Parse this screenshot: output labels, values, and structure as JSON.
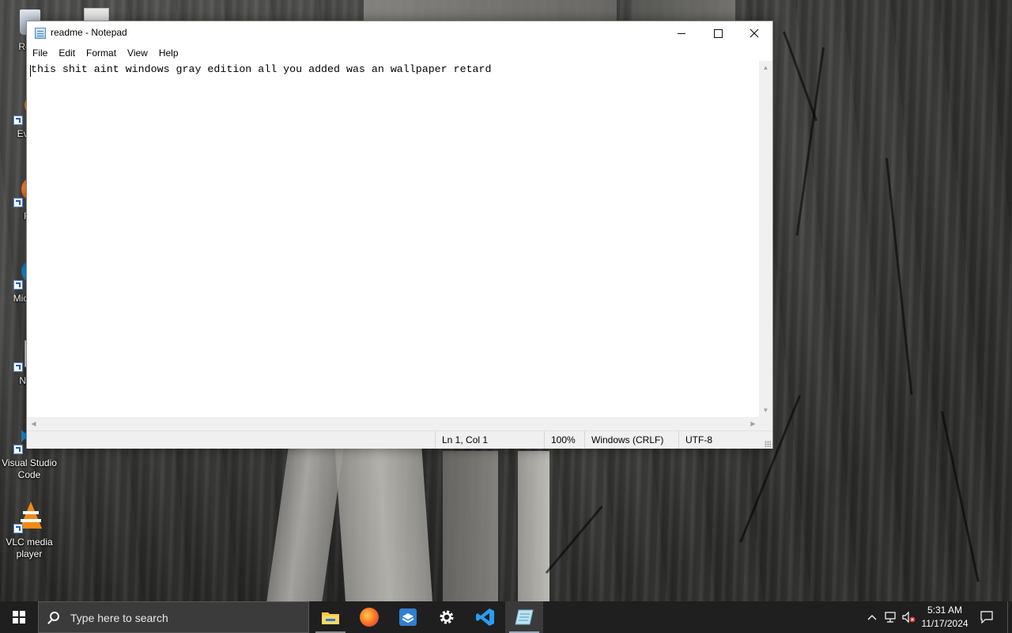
{
  "desktop": {
    "icons": [
      {
        "label": "Recy"
      },
      {
        "label": "Every"
      },
      {
        "label": "Fir"
      },
      {
        "label": "Micr Ed"
      },
      {
        "label": "Note"
      },
      {
        "label": "Visual Studio Code"
      },
      {
        "label": "VLC media player"
      }
    ]
  },
  "notepad": {
    "title": "readme - Notepad",
    "menu": [
      "File",
      "Edit",
      "Format",
      "View",
      "Help"
    ],
    "content": "this shit aint windows gray edition all you added was an wallpaper retard",
    "status": {
      "position": "Ln 1, Col 1",
      "zoom": "100%",
      "line_ending": "Windows (CRLF)",
      "encoding": "UTF-8"
    }
  },
  "taskbar": {
    "search_placeholder": "Type here to search",
    "pinned": [
      "file-explorer-icon",
      "firefox-icon",
      "virtualbox-icon",
      "settings-icon",
      "vscode-icon",
      "notepad-icon"
    ],
    "clock": {
      "time": "5:31 AM",
      "date": "11/17/2024"
    }
  }
}
